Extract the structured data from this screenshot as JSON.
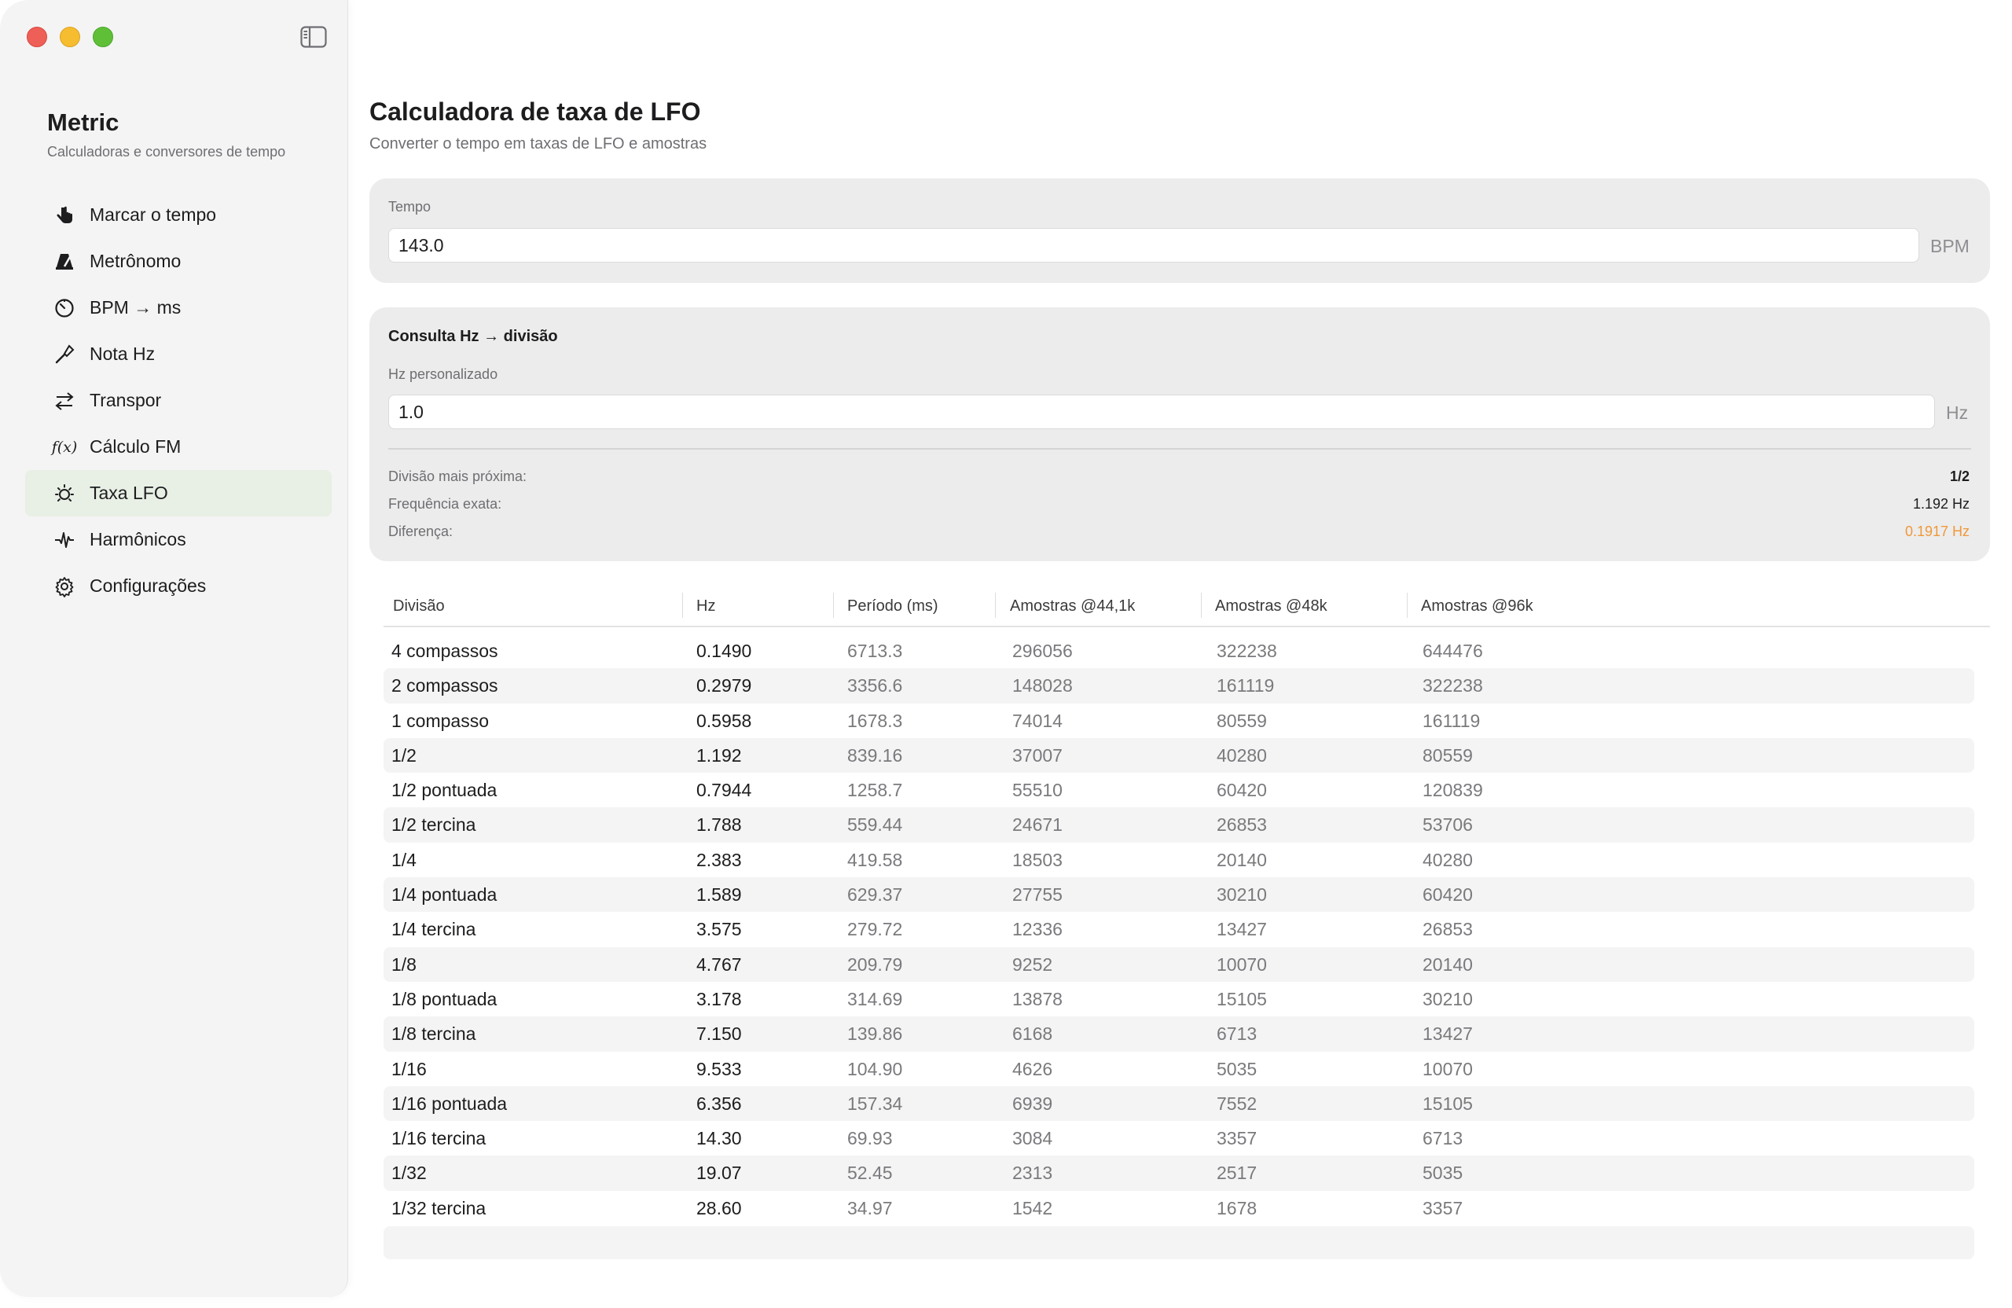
{
  "app": {
    "title": "Metric",
    "subtitle": "Calculadoras e conversores de tempo"
  },
  "sidebar": {
    "items": [
      {
        "label": "Marcar o tempo",
        "icon": "tap-hand-icon"
      },
      {
        "label": "Metrônomo",
        "icon": "metronome-icon"
      },
      {
        "label": "BPM → ms",
        "icon": "timer-icon"
      },
      {
        "label": "Nota Hz",
        "icon": "tuning-fork-icon"
      },
      {
        "label": "Transpor",
        "icon": "transpose-arrows-icon"
      },
      {
        "label": "Cálculo FM",
        "icon": "function-icon",
        "glyph": "f(x)"
      },
      {
        "label": "Taxa LFO",
        "icon": "lfo-sun-icon",
        "active": true
      },
      {
        "label": "Harmônicos",
        "icon": "waveform-icon"
      },
      {
        "label": "Configurações",
        "icon": "gear-icon"
      }
    ]
  },
  "page": {
    "title": "Calculadora de taxa de LFO",
    "subtitle": "Converter o tempo em taxas de LFO e amostras"
  },
  "tempo": {
    "label": "Tempo",
    "value": "143.0",
    "unit": "BPM"
  },
  "consulta": {
    "title": "Consulta Hz → divisão",
    "hz_label": "Hz personalizado",
    "hz_value": "1.0",
    "hz_unit": "Hz",
    "results": {
      "nearest_label": "Divisão mais próxima:",
      "nearest_value": "1/2",
      "exact_label": "Frequência exata:",
      "exact_value": "1.192 Hz",
      "diff_label": "Diferença:",
      "diff_value": "0.1917 Hz"
    }
  },
  "colors": {
    "accent_orange": "#f0983a",
    "active_bg": "#e8efe4"
  },
  "table": {
    "headers": [
      "Divisão",
      "Hz",
      "Período (ms)",
      "Amostras @44,1k",
      "Amostras @48k",
      "Amostras @96k"
    ],
    "rows": [
      [
        "4 compassos",
        "0.1490",
        "6713.3",
        "296056",
        "322238",
        "644476"
      ],
      [
        "2 compassos",
        "0.2979",
        "3356.6",
        "148028",
        "161119",
        "322238"
      ],
      [
        "1 compasso",
        "0.5958",
        "1678.3",
        "74014",
        "80559",
        "161119"
      ],
      [
        "1/2",
        "1.192",
        "839.16",
        "37007",
        "40280",
        "80559"
      ],
      [
        "1/2 pontuada",
        "0.7944",
        "1258.7",
        "55510",
        "60420",
        "120839"
      ],
      [
        "1/2 tercina",
        "1.788",
        "559.44",
        "24671",
        "26853",
        "53706"
      ],
      [
        "1/4",
        "2.383",
        "419.58",
        "18503",
        "20140",
        "40280"
      ],
      [
        "1/4 pontuada",
        "1.589",
        "629.37",
        "27755",
        "30210",
        "60420"
      ],
      [
        "1/4 tercina",
        "3.575",
        "279.72",
        "12336",
        "13427",
        "26853"
      ],
      [
        "1/8",
        "4.767",
        "209.79",
        "9252",
        "10070",
        "20140"
      ],
      [
        "1/8 pontuada",
        "3.178",
        "314.69",
        "13878",
        "15105",
        "30210"
      ],
      [
        "1/8 tercina",
        "7.150",
        "139.86",
        "6168",
        "6713",
        "13427"
      ],
      [
        "1/16",
        "9.533",
        "104.90",
        "4626",
        "5035",
        "10070"
      ],
      [
        "1/16 pontuada",
        "6.356",
        "157.34",
        "6939",
        "7552",
        "15105"
      ],
      [
        "1/16 tercina",
        "14.30",
        "69.93",
        "3084",
        "3357",
        "6713"
      ],
      [
        "1/32",
        "19.07",
        "52.45",
        "2313",
        "2517",
        "5035"
      ],
      [
        "1/32 tercina",
        "28.60",
        "34.97",
        "1542",
        "1678",
        "3357"
      ]
    ]
  }
}
